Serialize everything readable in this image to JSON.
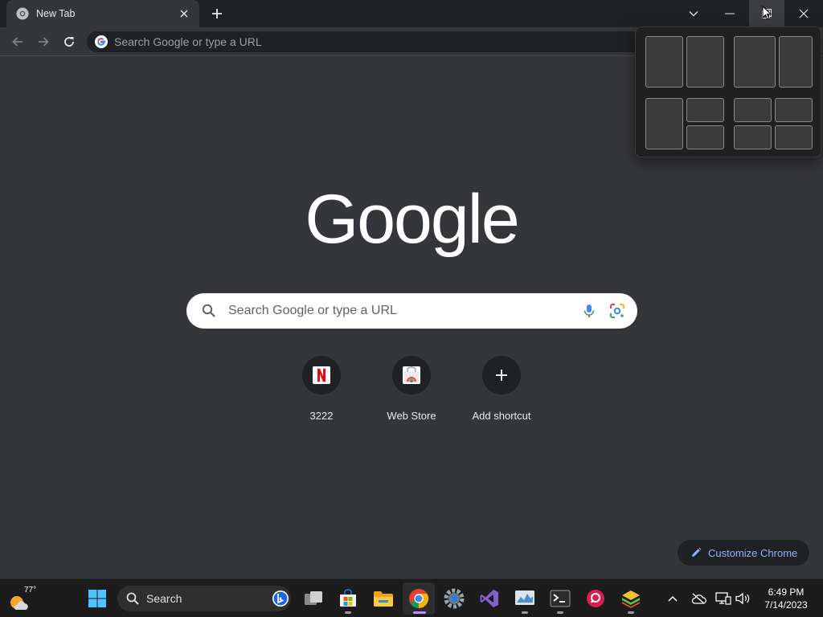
{
  "browser": {
    "tab": {
      "title": "New Tab"
    },
    "omnibox": {
      "placeholder": "Search Google or type a URL",
      "value": ""
    }
  },
  "snap_layouts": {
    "layouts": [
      "two-halves",
      "wide-narrow",
      "half-and-quarters",
      "four-quarters"
    ]
  },
  "page": {
    "logo_text": "Google",
    "search": {
      "placeholder": "Search Google or type a URL"
    },
    "shortcuts": [
      {
        "label": "3222",
        "icon": "netflix-icon"
      },
      {
        "label": "Web Store",
        "icon": "web-store-icon"
      },
      {
        "label": "Add shortcut",
        "icon": "plus-icon"
      }
    ],
    "customize_label": "Customize Chrome"
  },
  "taskbar": {
    "weather": {
      "temperature": "77°"
    },
    "search_label": "Search",
    "apps": [
      "windows-start",
      "task-view",
      "microsoft-store",
      "file-explorer",
      "google-chrome",
      "settings",
      "visual-studio",
      "resource-monitor",
      "terminal",
      "app-red",
      "bluestacks"
    ],
    "clock": {
      "time": "6:49 PM",
      "date": "7/14/2023"
    }
  },
  "colors": {
    "page_bg": "#35363a",
    "titlebar_bg": "#202124",
    "accent_link": "#8ab4f8",
    "chrome_active_indicator": "#c58af9"
  }
}
